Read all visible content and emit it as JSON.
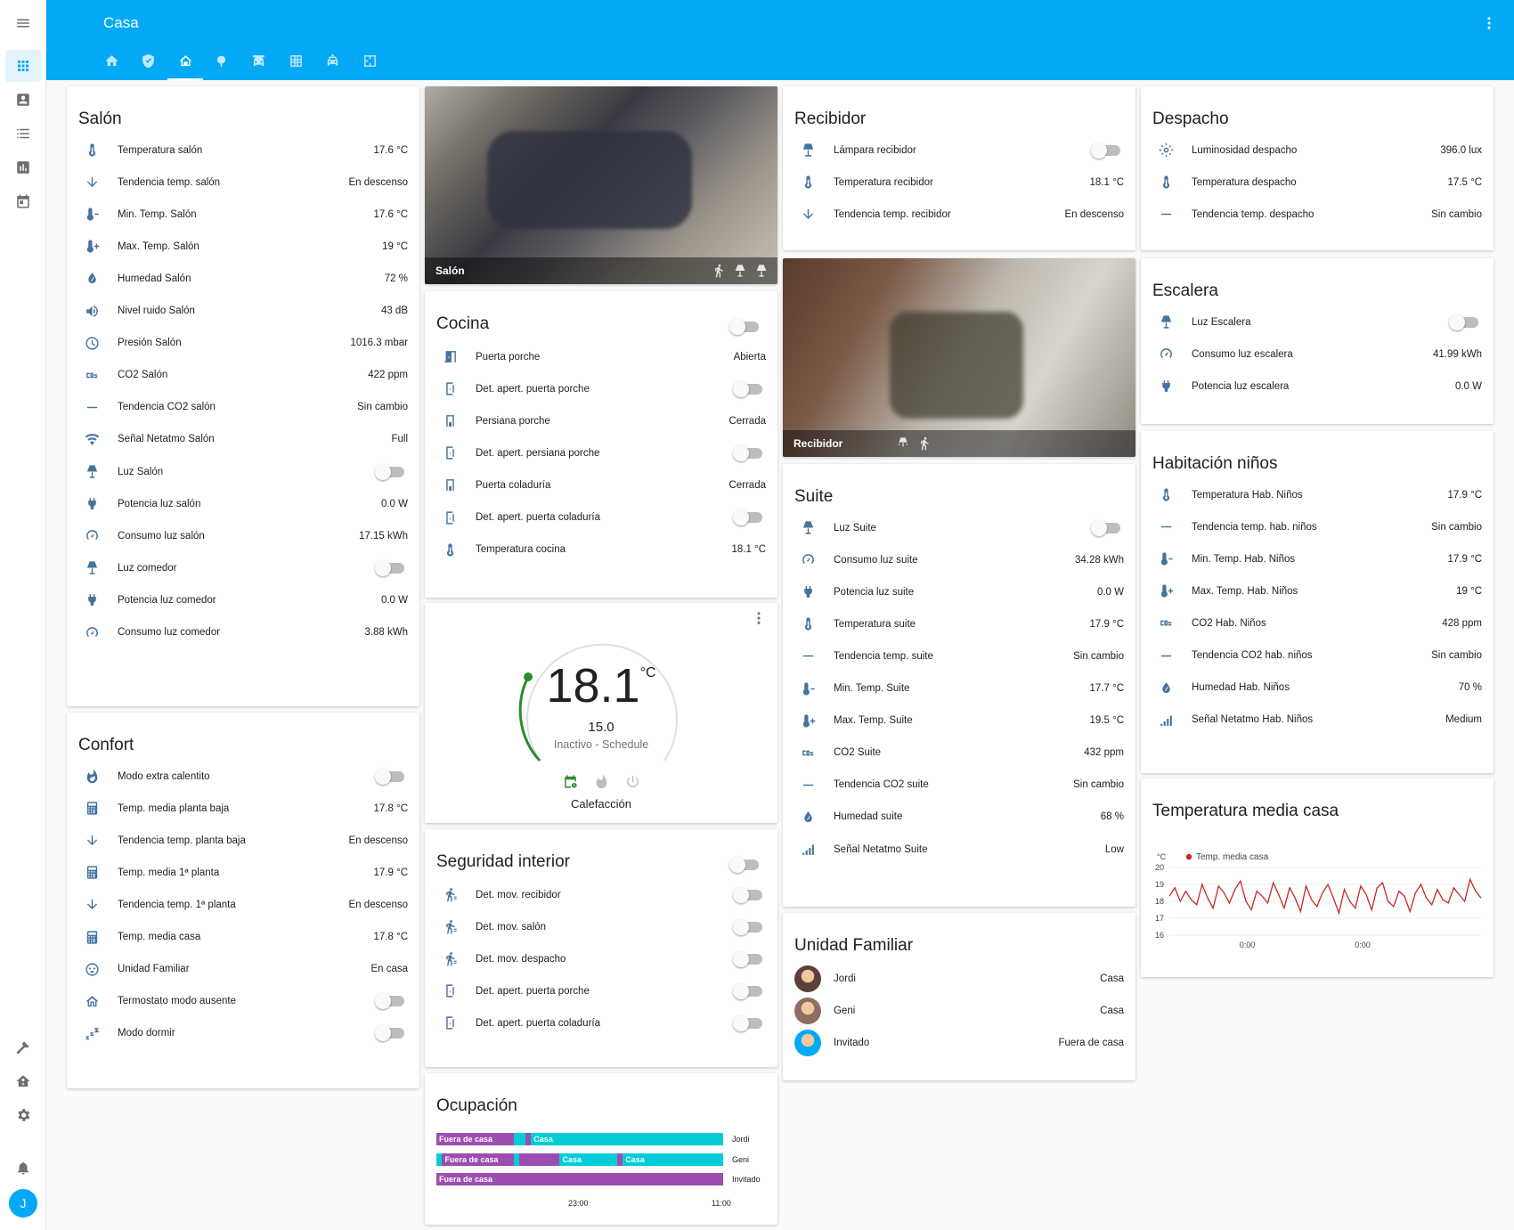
{
  "header": {
    "title": "Casa"
  },
  "sidebar": {
    "user_initial": "J"
  },
  "tabs": [
    {
      "icon": "home-icon"
    },
    {
      "icon": "shield-icon"
    },
    {
      "icon": "house-icon",
      "active": true
    },
    {
      "icon": "tree-icon"
    },
    {
      "icon": "car-icon"
    },
    {
      "icon": "grid-icon"
    },
    {
      "icon": "car-front-icon"
    },
    {
      "icon": "floorplan-icon"
    }
  ],
  "salon": {
    "title": "Salón",
    "rows": [
      {
        "icon": "thermometer",
        "name": "Temperatura salón",
        "value": "17.6 °C"
      },
      {
        "icon": "arrow-down",
        "name": "Tendencia temp. salón",
        "value": "En descenso"
      },
      {
        "icon": "thermo-minus",
        "name": "Min. Temp. Salón",
        "value": "17.6 °C"
      },
      {
        "icon": "thermo-plus",
        "name": "Max. Temp. Salón",
        "value": "19 °C"
      },
      {
        "icon": "water",
        "name": "Humedad Salón",
        "value": "72 %"
      },
      {
        "icon": "volume",
        "name": "Nivel ruido Salón",
        "value": "43 dB"
      },
      {
        "icon": "gauge",
        "name": "Presión Salón",
        "value": "1016.3 mbar"
      },
      {
        "icon": "co2",
        "name": "CO2 Salón",
        "value": "422 ppm"
      },
      {
        "icon": "minus",
        "name": "Tendencia CO2 salón",
        "value": "Sin cambio"
      },
      {
        "icon": "wifi",
        "name": "Señal Netatmo Salón",
        "value": "Full"
      },
      {
        "icon": "lamp",
        "name": "Luz Salón",
        "toggle": true
      },
      {
        "icon": "plug",
        "name": "Potencia luz salón",
        "value": "0.0 W"
      },
      {
        "icon": "speedometer",
        "name": "Consumo luz salón",
        "value": "17.15 kWh"
      },
      {
        "icon": "lamp",
        "name": "Luz comedor",
        "toggle": true
      },
      {
        "icon": "plug",
        "name": "Potencia luz comedor",
        "value": "0.0 W"
      },
      {
        "icon": "speedometer",
        "name": "Consumo luz comedor",
        "value": "3.88 kWh"
      }
    ]
  },
  "confort": {
    "title": "Confort",
    "rows": [
      {
        "icon": "fire",
        "name": "Modo extra calentito",
        "toggle": true
      },
      {
        "icon": "calculator",
        "name": "Temp. media planta baja",
        "value": "17.8 °C"
      },
      {
        "icon": "arrow-down",
        "name": "Tendencia temp. planta baja",
        "value": "En descenso"
      },
      {
        "icon": "calculator",
        "name": "Temp. media 1ª planta",
        "value": "17.9 °C"
      },
      {
        "icon": "arrow-down",
        "name": "Tendencia temp. 1ª planta",
        "value": "En descenso"
      },
      {
        "icon": "calculator",
        "name": "Temp. media casa",
        "value": "17.8 °C"
      },
      {
        "icon": "family",
        "name": "Unidad Familiar",
        "value": "En casa"
      },
      {
        "icon": "home-outline",
        "name": "Termostato modo ausente",
        "toggle": true
      },
      {
        "icon": "sleep",
        "name": "Modo dormir",
        "toggle": true
      }
    ]
  },
  "camera_salon": {
    "label": "Salón"
  },
  "camera_recibidor": {
    "label": "Recibidor"
  },
  "cocina": {
    "title": "Cocina",
    "rows": [
      {
        "icon": "door-open",
        "name": "Puerta porche",
        "value": "Abierta"
      },
      {
        "icon": "door-sensor",
        "name": "Det. apert. puerta porche",
        "toggle": true
      },
      {
        "icon": "blind",
        "name": "Persiana porche",
        "value": "Cerrada"
      },
      {
        "icon": "door-sensor",
        "name": "Det. apert. persiana porche",
        "toggle": true
      },
      {
        "icon": "blind",
        "name": "Puerta coladuría",
        "value": "Cerrada"
      },
      {
        "icon": "door-sensor",
        "name": "Det. apert. puerta coladuría",
        "toggle": true
      },
      {
        "icon": "thermometer",
        "name": "Temperatura cocina",
        "value": "18.1 °C"
      }
    ]
  },
  "thermostat": {
    "current": "18.1",
    "unit": "°C",
    "target": "15.0",
    "state": "Inactivo - Schedule",
    "name": "Calefacción"
  },
  "seguridad": {
    "title": "Seguridad interior",
    "rows": [
      {
        "icon": "walk",
        "name": "Det. mov. recibidor",
        "toggle": true
      },
      {
        "icon": "walk",
        "name": "Det. mov. salón",
        "toggle": true
      },
      {
        "icon": "walk",
        "name": "Det. mov. despacho",
        "toggle": true
      },
      {
        "icon": "door-sensor",
        "name": "Det. apert. puerta porche",
        "toggle": true
      },
      {
        "icon": "door-sensor",
        "name": "Det. apert. puerta coladuría",
        "toggle": true
      }
    ]
  },
  "ocupacion": {
    "title": "Ocupación",
    "rows": [
      {
        "person": "Jordi",
        "segments": [
          {
            "label": "Fuera de casa",
            "frac": 0.27,
            "color": "#9c4db0"
          },
          {
            "label": "",
            "frac": 0.04,
            "color": "#00cdd6"
          },
          {
            "label": "",
            "frac": 0.02,
            "color": "#9c4db0"
          },
          {
            "label": "Casa",
            "frac": 0.67,
            "color": "#00cdd6"
          }
        ]
      },
      {
        "person": "Geni",
        "segments": [
          {
            "label": "",
            "frac": 0.02,
            "color": "#00cdd6"
          },
          {
            "label": "Fuera de casa",
            "frac": 0.25,
            "color": "#9c4db0"
          },
          {
            "label": "",
            "frac": 0.02,
            "color": "#00cdd6"
          },
          {
            "label": "",
            "frac": 0.14,
            "color": "#9c4db0"
          },
          {
            "label": "Casa",
            "frac": 0.2,
            "color": "#00cdd6"
          },
          {
            "label": "",
            "frac": 0.02,
            "color": "#9c4db0"
          },
          {
            "label": "Casa",
            "frac": 0.35,
            "color": "#00cdd6"
          }
        ]
      },
      {
        "person": "Invitado",
        "segments": [
          {
            "label": "Fuera de casa",
            "frac": 1.0,
            "color": "#9c4db0"
          }
        ]
      }
    ],
    "ticks": [
      "23:00",
      "11:00"
    ]
  },
  "recibidor": {
    "title": "Recibidor",
    "rows": [
      {
        "icon": "lamp-desk",
        "name": "Lámpara recibidor",
        "toggle": true
      },
      {
        "icon": "thermometer",
        "name": "Temperatura recibidor",
        "value": "18.1 °C"
      },
      {
        "icon": "arrow-down",
        "name": "Tendencia temp. recibidor",
        "value": "En descenso"
      }
    ]
  },
  "suite": {
    "title": "Suite",
    "rows": [
      {
        "icon": "lamp",
        "name": "Luz Suite",
        "toggle": true
      },
      {
        "icon": "speedometer",
        "name": "Consumo luz suite",
        "value": "34.28 kWh"
      },
      {
        "icon": "plug",
        "name": "Potencia luz suite",
        "value": "0.0 W"
      },
      {
        "icon": "thermometer",
        "name": "Temperatura suite",
        "value": "17.9 °C"
      },
      {
        "icon": "minus",
        "name": "Tendencia temp. suite",
        "value": "Sin cambio"
      },
      {
        "icon": "thermo-minus",
        "name": "Min. Temp. Suite",
        "value": "17.7 °C"
      },
      {
        "icon": "thermo-plus",
        "name": "Max. Temp. Suite",
        "value": "19.5 °C"
      },
      {
        "icon": "co2",
        "name": "CO2 Suite",
        "value": "432 ppm"
      },
      {
        "icon": "minus",
        "name": "Tendencia CO2 suite",
        "value": "Sin cambio"
      },
      {
        "icon": "water",
        "name": "Humedad suite",
        "value": "68 %"
      },
      {
        "icon": "signal",
        "name": "Señal Netatmo Suite",
        "value": "Low"
      }
    ]
  },
  "familia": {
    "title": "Unidad Familiar",
    "rows": [
      {
        "name": "Jordi",
        "value": "Casa",
        "avatar": "#5d4037"
      },
      {
        "name": "Geni",
        "value": "Casa",
        "avatar": "#8d6e63"
      },
      {
        "name": "Invitado",
        "value": "Fuera de casa",
        "avatar": "#03a9f4"
      }
    ]
  },
  "despacho": {
    "title": "Despacho",
    "rows": [
      {
        "icon": "brightness",
        "name": "Luminosidad despacho",
        "value": "396.0 lux"
      },
      {
        "icon": "thermometer",
        "name": "Temperatura despacho",
        "value": "17.5 °C"
      },
      {
        "icon": "minus",
        "name": "Tendencia temp. despacho",
        "value": "Sin cambio"
      }
    ]
  },
  "escalera": {
    "title": "Escalera",
    "rows": [
      {
        "icon": "lamp",
        "name": "Luz Escalera",
        "toggle": true
      },
      {
        "icon": "speedometer",
        "name": "Consumo luz escalera",
        "value": "41.99 kWh"
      },
      {
        "icon": "plug",
        "name": "Potencia luz escalera",
        "value": "0.0 W"
      }
    ]
  },
  "ninos": {
    "title": "Habitación niños",
    "rows": [
      {
        "icon": "thermometer",
        "name": "Temperatura Hab. Niños",
        "value": "17.9 °C"
      },
      {
        "icon": "minus",
        "name": "Tendencia temp. hab. niños",
        "value": "Sin cambio"
      },
      {
        "icon": "thermo-minus",
        "name": "Min. Temp. Hab. Niños",
        "value": "17.9 °C"
      },
      {
        "icon": "thermo-plus",
        "name": "Max. Temp. Hab. Niños",
        "value": "19 °C"
      },
      {
        "icon": "co2",
        "name": "CO2 Hab. Niños",
        "value": "428 ppm"
      },
      {
        "icon": "minus",
        "name": "Tendencia CO2 hab. niños",
        "value": "Sin cambio"
      },
      {
        "icon": "water",
        "name": "Humedad Hab. Niños",
        "value": "70 %"
      },
      {
        "icon": "signal",
        "name": "Señal Netatmo Hab. Niños",
        "value": "Medium"
      }
    ]
  },
  "temp_media": {
    "title": "Temperatura media casa"
  },
  "chart_data": {
    "type": "line",
    "series": [
      {
        "name": "Temp. media casa",
        "color": "#c62828",
        "values": [
          18.3,
          18.8,
          18.0,
          18.6,
          18.1,
          17.8,
          19.0,
          18.2,
          17.6,
          18.9,
          18.5,
          17.9,
          18.7,
          19.2,
          18.0,
          17.5,
          18.6,
          18.3,
          17.9,
          19.1,
          18.4,
          17.6,
          18.8,
          18.2,
          17.4,
          18.9,
          18.1,
          17.7,
          18.5,
          19.0,
          18.2,
          17.3,
          18.7,
          18.0,
          17.6,
          18.9,
          18.4,
          17.5,
          18.8,
          19.1,
          18.0,
          17.7,
          18.6,
          18.3,
          17.4,
          18.5,
          19.0,
          18.2,
          17.8,
          18.7,
          18.1,
          17.9,
          18.8,
          18.4,
          18.0,
          19.3,
          18.6,
          18.2
        ]
      }
    ],
    "y_unit": "°C",
    "ylim": [
      16,
      20
    ],
    "yticks": [
      "20",
      "19",
      "18",
      "17",
      "16"
    ],
    "xticks": [
      "0:00",
      "0:00"
    ]
  }
}
